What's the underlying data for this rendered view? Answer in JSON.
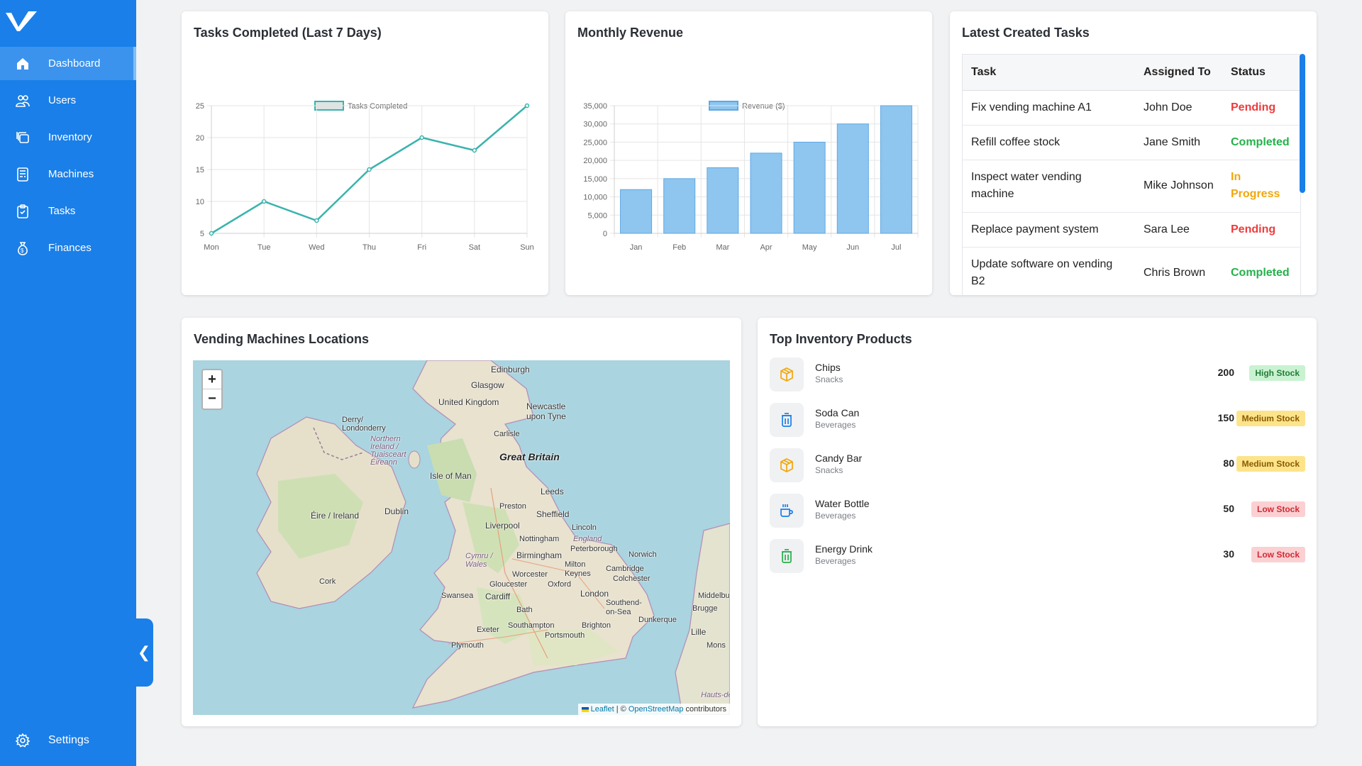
{
  "sidebar": {
    "items": [
      {
        "label": "Dashboard",
        "icon": "home-icon",
        "active": true
      },
      {
        "label": "Users",
        "icon": "users-icon"
      },
      {
        "label": "Inventory",
        "icon": "inventory-icon"
      },
      {
        "label": "Machines",
        "icon": "machine-icon"
      },
      {
        "label": "Tasks",
        "icon": "tasks-icon"
      },
      {
        "label": "Finances",
        "icon": "money-bag-icon"
      }
    ],
    "settings_label": "Settings",
    "collapse_glyph": "❮"
  },
  "colors": {
    "primary": "#1a7fe8",
    "line": "#3bb3ad",
    "bar": "#8ec6f0"
  },
  "tasks_card": {
    "title": "Tasks Completed (Last 7 Days)"
  },
  "revenue_card": {
    "title": "Monthly Revenue"
  },
  "chart_data": [
    {
      "type": "line",
      "title": "Tasks Completed (Last 7 Days)",
      "legend": "Tasks Completed",
      "legend_position": "top",
      "categories": [
        "Mon",
        "Tue",
        "Wed",
        "Thu",
        "Fri",
        "Sat",
        "Sun"
      ],
      "values": [
        5,
        10,
        7,
        15,
        20,
        18,
        25
      ],
      "yticks": [
        "5",
        "10",
        "15",
        "20",
        "25"
      ],
      "ylim": [
        5,
        25
      ],
      "grid": true
    },
    {
      "type": "bar",
      "title": "Monthly Revenue",
      "legend": "Revenue ($)",
      "legend_position": "top",
      "categories": [
        "Jan",
        "Feb",
        "Mar",
        "Apr",
        "May",
        "Jun",
        "Jul"
      ],
      "values": [
        12000,
        15000,
        18000,
        22000,
        25000,
        30000,
        35000
      ],
      "yticks": [
        "0",
        "5,000",
        "10,000",
        "15,000",
        "20,000",
        "25,000",
        "30,000",
        "35,000"
      ],
      "ylim": [
        0,
        35000
      ],
      "grid": true
    }
  ],
  "latest_tasks": {
    "title": "Latest Created Tasks",
    "headers": [
      "Task",
      "Assigned To",
      "Status"
    ],
    "rows": [
      {
        "task": "Fix vending machine A1",
        "assigned": "John Doe",
        "status": "Pending"
      },
      {
        "task": "Refill coffee stock",
        "assigned": "Jane Smith",
        "status": "Completed"
      },
      {
        "task": "Inspect water vending machine",
        "assigned": "Mike Johnson",
        "status": "In Progress"
      },
      {
        "task": "Replace payment system",
        "assigned": "Sara Lee",
        "status": "Pending"
      },
      {
        "task": "Update software on vending B2",
        "assigned": "Chris Brown",
        "status": "Completed"
      }
    ]
  },
  "map_card": {
    "title": "Vending Machines Locations",
    "zoom_in": "+",
    "zoom_out": "−",
    "attribution": {
      "leaflet": "Leaflet",
      "sep": " | © ",
      "osm": "OpenStreetMap",
      "suffix": " contributors"
    },
    "labels": [
      "Edinburgh",
      "Glasgow",
      "United Kingdom",
      "Newcastle upon Tyne",
      "Derry/ Londonderry",
      "Northern Ireland / Tuaisceart Éireann",
      "Carlisle",
      "Great Britain",
      "Isle of Man",
      "Leeds",
      "Preston",
      "Sheffield",
      "Éire / Ireland",
      "Dublin",
      "Liverpool",
      "Lincoln",
      "Nottingham",
      "England",
      "Birmingham",
      "Peterborough",
      "Norwich",
      "Cymru / Wales",
      "Milton Keynes",
      "Cambridge",
      "Colchester",
      "Cork",
      "Worcester",
      "Gloucester",
      "Oxford",
      "Swansea",
      "Cardiff",
      "London",
      "Southend-on-Sea",
      "Middelburg",
      "Bath",
      "Brugge",
      "Exeter",
      "Southampton",
      "Brighton",
      "Dunkerque",
      "Portsmouth",
      "Lille",
      "Plymouth",
      "Mons",
      "Hauts-de-"
    ]
  },
  "inventory_card": {
    "title": "Top Inventory Products",
    "items": [
      {
        "name": "Chips",
        "category": "Snacks",
        "qty": "200",
        "badge": "High Stock",
        "level": "high",
        "icon": "box-icon"
      },
      {
        "name": "Soda Can",
        "category": "Beverages",
        "qty": "150",
        "badge": "Medium Stock",
        "level": "medium",
        "icon": "can-icon"
      },
      {
        "name": "Candy Bar",
        "category": "Snacks",
        "qty": "80",
        "badge": "Medium Stock",
        "level": "medium",
        "icon": "box-icon"
      },
      {
        "name": "Water Bottle",
        "category": "Beverages",
        "qty": "50",
        "badge": "Low Stock",
        "level": "low",
        "icon": "cup-icon"
      },
      {
        "name": "Energy Drink",
        "category": "Beverages",
        "qty": "30",
        "badge": "Low Stock",
        "level": "low",
        "icon": "can-icon"
      }
    ]
  }
}
